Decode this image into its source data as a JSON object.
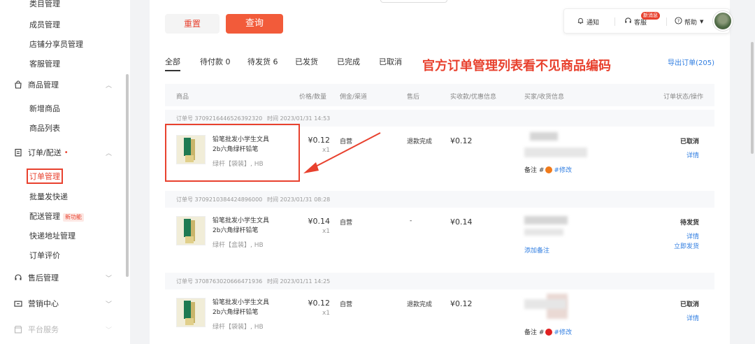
{
  "sidebar": {
    "top_items": [
      "类目管理",
      "成员管理",
      "店铺分享员管理",
      "客服管理"
    ],
    "groups": [
      {
        "label": "商品管理",
        "icon": "bag-icon",
        "chevron": "︿"
      },
      {
        "label": "订单/配送",
        "icon": "clipboard-icon",
        "dot": "•",
        "chevron": "︿"
      },
      {
        "label": "售后管理",
        "icon": "headset-icon",
        "chevron": "﹀"
      },
      {
        "label": "营销中心",
        "icon": "coupon-icon",
        "chevron": "﹀"
      },
      {
        "label": "平台服务",
        "icon": "store-icon",
        "chevron": "﹀"
      }
    ],
    "product_items": [
      "新增商品",
      "商品列表"
    ],
    "order_items": [
      "订单管理",
      "批量发快递",
      "配送管理",
      "快递地址管理",
      "订单评价"
    ],
    "new_tag": "新功能"
  },
  "actions": {
    "reset": "重置",
    "query": "查询"
  },
  "topbar": {
    "notify": "通知",
    "service": "客服",
    "new_msg": "新消息",
    "help": "帮助"
  },
  "tabs": [
    "全部",
    "待付款 0",
    "待发货 6",
    "已发货",
    "已完成",
    "已取消"
  ],
  "annotation": "官方订单管理列表看不见商品编码",
  "export": "导出订单(205)",
  "table_headers": [
    "商品",
    "价格/数量",
    "佣金/渠道",
    "售后",
    "实收款/优惠信息",
    "买家/收货信息",
    "订单状态/操作"
  ],
  "orders": [
    {
      "order_no_label": "订单号 3709216446526392320",
      "time_label": "时间 2023/01/31 14:53",
      "product_name": "铅笔批发小学生文具2b六角绿杆铅笔",
      "spec": "绿杆【袋装】, HB",
      "price": "¥0.12",
      "qty": "x1",
      "channel": "自营",
      "aftersale": "退款完成",
      "paid": "¥0.12",
      "note_prefix": "备注 #",
      "note_edit": "#修改",
      "flag_color": "#f07a1a",
      "status": "已取消",
      "actions": [
        "详情"
      ]
    },
    {
      "order_no_label": "订单号 3709210384424896000",
      "time_label": "时间 2023/01/31 08:28",
      "product_name": "铅笔批发小学生文具2b六角绿杆铅笔",
      "spec": "绿杆【盒装】, HB",
      "price": "¥0.14",
      "qty": "x1",
      "channel": "自营",
      "aftersale": "-",
      "paid": "¥0.14",
      "add_note": "添加备注",
      "status": "待发货",
      "actions": [
        "详情",
        "立即发货"
      ]
    },
    {
      "order_no_label": "订单号 3708763020666471936",
      "time_label": "时间 2023/01/11 14:25",
      "product_name": "铅笔批发小学生文具2b六角绿杆铅笔",
      "spec": "绿杆【袋装】, HB",
      "price": "¥0.12",
      "qty": "x1",
      "channel": "自营",
      "aftersale": "退款完成",
      "paid": "¥0.12",
      "note_prefix": "备注 #",
      "note_edit": "#修改",
      "flag_color": "#e02020",
      "status": "已取消",
      "actions": [
        "详情"
      ]
    }
  ],
  "colors": {
    "accent": "#f25b3a",
    "annotation_red": "#e8412e",
    "link_blue": "#2f7de1"
  }
}
